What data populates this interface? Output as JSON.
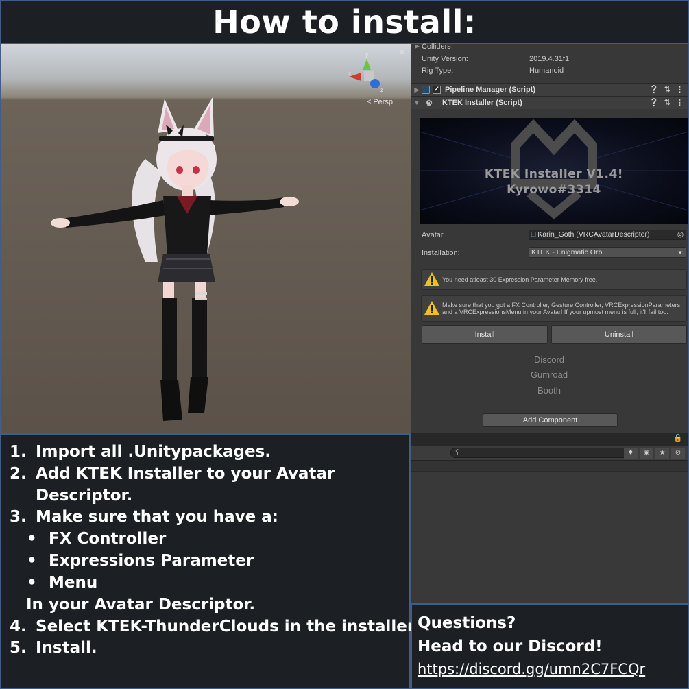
{
  "title": "How to install:",
  "scene": {
    "projection_label": "≤ Persp",
    "axis_labels": {
      "y": "y",
      "x": "x",
      "z": "z"
    }
  },
  "inspector": {
    "colliders_label": "Colliders",
    "unity_version_label": "Unity Version:",
    "unity_version_value": "2019.4.31f1",
    "rig_type_label": "Rig Type:",
    "rig_type_value": "Humanoid",
    "components": [
      {
        "name": "Pipeline Manager (Script)"
      },
      {
        "name": "KTEK Installer (Script)"
      }
    ],
    "banner": {
      "line1": "KTEK Installer V1.4!",
      "line2": "Kyrowo#3314"
    },
    "avatar_label": "Avatar",
    "avatar_value": "Karin_Goth (VRCAvatarDescriptor)",
    "installation_label": "Installation:",
    "installation_value": "KTEK - Enigmatic Orb",
    "warning_1": "You need atleast 30 Expression Parameter Memory free.",
    "warning_2": "Make sure that you got a FX Controller, Gesture Controller, VRCExpressionParameters and a VRCExpressionsMenu in your Avatar! If your upmost menu is full, it'll fail too.",
    "install_button": "Install",
    "uninstall_button": "Uninstall",
    "links": [
      "Discord",
      "Gumroad",
      "Booth"
    ],
    "add_component_button": "Add Component"
  },
  "steps": {
    "items": [
      {
        "num": "1.",
        "text": "Import all .Unitypackages."
      },
      {
        "num": "2.",
        "text": "Add KTEK Installer to your Avatar"
      },
      {
        "num": "",
        "text": "Descriptor."
      },
      {
        "num": "3.",
        "text": "Make sure that you have a:"
      }
    ],
    "bullets": [
      "FX Controller",
      "Expressions Parameter",
      "Menu"
    ],
    "bullet_char": "•",
    "after_bullets": "In your Avatar Descriptor.",
    "step4_num": "4.",
    "step4_text": "Select KTEK-ThunderClouds in the installer.",
    "step5_num": "5.",
    "step5_text": "Install."
  },
  "questions": {
    "line1": "Questions?",
    "line2": "Head to our Discord!",
    "link": "https://discord.gg/umn2C7FCQr"
  },
  "colors": {
    "background": "#1c2025",
    "border": "#3f5e8a",
    "inspector": "#383838"
  }
}
